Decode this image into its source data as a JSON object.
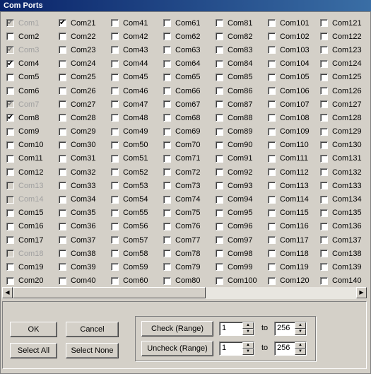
{
  "window": {
    "title": "Com Ports"
  },
  "ports": {
    "columns": [
      [
        "Com1",
        "Com2",
        "Com3",
        "Com4",
        "Com5",
        "Com6",
        "Com7",
        "Com8",
        "Com9",
        "Com10",
        "Com11",
        "Com12",
        "Com13",
        "Com14",
        "Com15",
        "Com16",
        "Com17",
        "Com18",
        "Com19",
        "Com20"
      ],
      [
        "Com21",
        "Com22",
        "Com23",
        "Com24",
        "Com25",
        "Com26",
        "Com27",
        "Com28",
        "Com29",
        "Com30",
        "Com31",
        "Com32",
        "Com33",
        "Com34",
        "Com35",
        "Com36",
        "Com37",
        "Com38",
        "Com39",
        "Com40"
      ],
      [
        "Com41",
        "Com42",
        "Com43",
        "Com44",
        "Com45",
        "Com46",
        "Com47",
        "Com48",
        "Com49",
        "Com50",
        "Com51",
        "Com52",
        "Com53",
        "Com54",
        "Com55",
        "Com56",
        "Com57",
        "Com58",
        "Com59",
        "Com60"
      ],
      [
        "Com61",
        "Com62",
        "Com63",
        "Com64",
        "Com65",
        "Com66",
        "Com67",
        "Com68",
        "Com69",
        "Com70",
        "Com71",
        "Com72",
        "Com73",
        "Com74",
        "Com75",
        "Com76",
        "Com77",
        "Com78",
        "Com79",
        "Com80"
      ],
      [
        "Com81",
        "Com82",
        "Com83",
        "Com84",
        "Com85",
        "Com86",
        "Com87",
        "Com88",
        "Com89",
        "Com90",
        "Com91",
        "Com92",
        "Com93",
        "Com94",
        "Com95",
        "Com96",
        "Com97",
        "Com98",
        "Com99",
        "Com100"
      ],
      [
        "Com101",
        "Com102",
        "Com103",
        "Com104",
        "Com105",
        "Com106",
        "Com107",
        "Com108",
        "Com109",
        "Com110",
        "Com111",
        "Com112",
        "Com113",
        "Com114",
        "Com115",
        "Com116",
        "Com117",
        "Com118",
        "Com119",
        "Com120"
      ],
      [
        "Com121",
        "Com122",
        "Com123",
        "Com124",
        "Com125",
        "Com126",
        "Com127",
        "Com128",
        "Com129",
        "Com130",
        "Com131",
        "Com132",
        "Com133",
        "Com134",
        "Com135",
        "Com136",
        "Com137",
        "Com138",
        "Com139",
        "Com140"
      ]
    ],
    "checked": [
      "Com1",
      "Com3",
      "Com4",
      "Com7",
      "Com8",
      "Com21"
    ],
    "disabled": [
      "Com1",
      "Com3",
      "Com7",
      "Com13",
      "Com14",
      "Com18"
    ]
  },
  "buttons": {
    "ok": "OK",
    "cancel": "Cancel",
    "select_all": "Select All",
    "select_none": "Select None",
    "check_range": "Check (Range)",
    "uncheck_range": "Uncheck (Range)"
  },
  "range": {
    "check_from": "1",
    "check_to": "256",
    "uncheck_from": "1",
    "uncheck_to": "256",
    "to_label": "to"
  },
  "icons": {
    "scroll_left": "left-arrow-icon",
    "scroll_right": "right-arrow-icon",
    "spin_up": "spin-up-icon",
    "spin_down": "spin-down-icon"
  }
}
